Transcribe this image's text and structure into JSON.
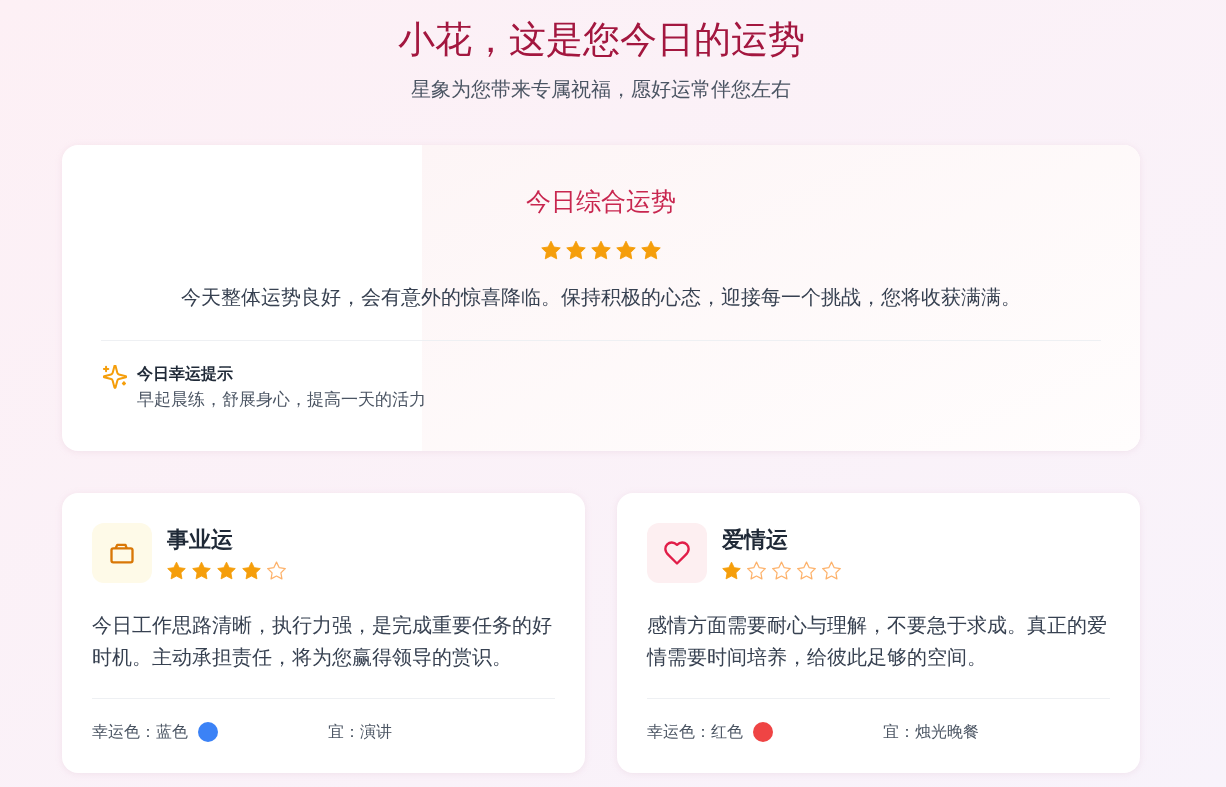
{
  "header": {
    "title": "小花，这是您今日的运势",
    "subtitle": "星象为您带来专属祝福，愿好运常伴您左右"
  },
  "overall": {
    "title": "今日综合运势",
    "stars": 5,
    "summary": "今天整体运势良好，会有意外的惊喜降临。保持积极的心态，迎接每一个挑战，您将收获满满。",
    "tip": {
      "title": "今日幸运提示",
      "text": "早起晨练，舒展身心，提高一天的活力"
    }
  },
  "aspects": [
    {
      "kind": "career",
      "title": "事业运",
      "stars": 4,
      "description": "今日工作思路清晰，执行力强，是完成重要任务的好时机。主动承担责任，将为您赢得领导的赏识。",
      "lucky_color_label": "幸运色：",
      "lucky_color": "蓝色",
      "color": "#3b82f6",
      "suitable_label": "宜：",
      "suitable": "演讲"
    },
    {
      "kind": "love",
      "title": "爱情运",
      "stars": 1,
      "description": "感情方面需要耐心与理解，不要急于求成。真正的爱情需要时间培养，给彼此足够的空间。",
      "lucky_color_label": "幸运色：",
      "lucky_color": "红色",
      "color": "#ef4444",
      "suitable_label": "宜：",
      "suitable": "烛光晚餐"
    }
  ]
}
